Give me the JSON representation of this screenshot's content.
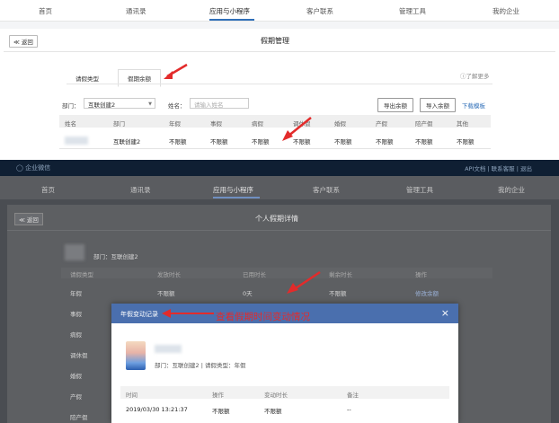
{
  "top_nav": {
    "items": [
      "首页",
      "通讯录",
      "应用与小程序",
      "客户联系",
      "管理工具",
      "我的企业"
    ],
    "active": "应用与小程序"
  },
  "leave_mgmt": {
    "back": "≪ 返回",
    "title": "假期管理",
    "tabs": [
      "请假类型",
      "假期余额"
    ],
    "learn_more": "了解更多",
    "dept_label": "部门：",
    "dept_value": "互联创建2",
    "name_label": "姓名：",
    "name_placeholder": "请输入姓名",
    "export_btn": "导出余额",
    "import_btn": "导入余额",
    "download_link": "下载模板",
    "columns": [
      "姓名",
      "部门",
      "年假",
      "事假",
      "病假",
      "调休假",
      "婚假",
      "产假",
      "陪产假",
      "其他"
    ],
    "row": [
      "",
      "互联创建2",
      "不限额",
      "不限额",
      "不限额",
      "不限额",
      "不限额",
      "不限额",
      "不限额",
      "不限额"
    ]
  },
  "detail": {
    "brand": "企业微信",
    "top_links": "API文档 | 联系客服 | 退出",
    "nav": [
      "首页",
      "通讯录",
      "应用与小程序",
      "客户联系",
      "管理工具",
      "我的企业"
    ],
    "back": "≪ 返回",
    "title": "个人假期详情",
    "dept": "部门：互联创建2",
    "columns": [
      "请假类型",
      "发放时长",
      "已用时长",
      "剩余时长",
      "操作"
    ],
    "rows": [
      [
        "年假",
        "不限额",
        "0天",
        "不限额",
        "修改余额"
      ],
      [
        "事假"
      ],
      [
        "病假"
      ],
      [
        "调休假"
      ],
      [
        "婚假"
      ],
      [
        "产假"
      ],
      [
        "陪产假"
      ]
    ]
  },
  "modal": {
    "title": "年假变动记录",
    "close": "×",
    "info": "部门：互联创建2  |  请假类型：年假",
    "columns": [
      "时间",
      "操作",
      "变动时长",
      "备注"
    ],
    "row": [
      "2019/03/30 13:21:37",
      "不限额",
      "不限额",
      "--"
    ]
  },
  "annotation": "查看假期时间变动情况",
  "colors": {
    "accent": "#2f6fb8",
    "annotation": "#e32b2b",
    "modal_header": "#4a6fae"
  }
}
